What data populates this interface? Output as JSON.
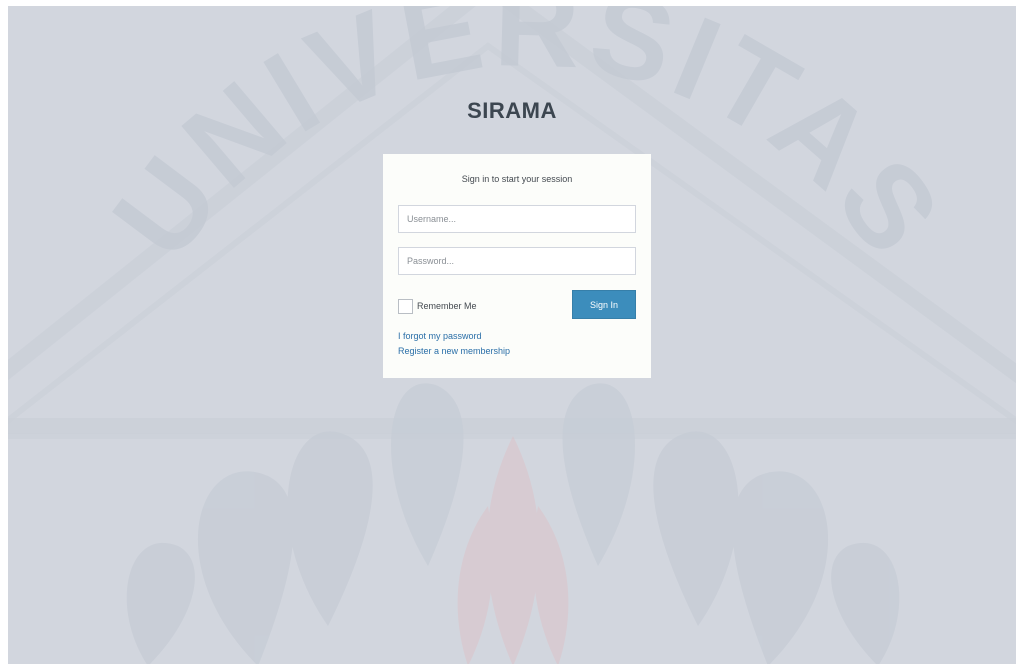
{
  "app": {
    "title": "SIRAMA"
  },
  "login": {
    "message": "Sign in to start your session",
    "username_placeholder": "Username...",
    "password_placeholder": "Password...",
    "remember_label": "Remember Me",
    "signin_label": "Sign In",
    "forgot_link": "I forgot my password",
    "register_link": "Register a new membership"
  },
  "watermark": {
    "text": "UNIVERSITAS",
    "color": "#c3c9d3"
  },
  "colors": {
    "background": "#d2d6de",
    "box": "#fcfdfa",
    "primary": "#3c8dbc",
    "link": "#2a6fa8"
  }
}
